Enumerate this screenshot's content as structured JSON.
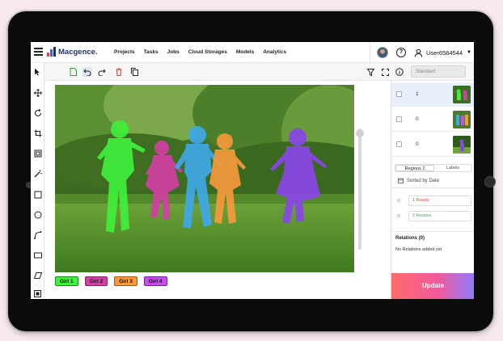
{
  "app": {
    "logo_text": "Macgence.",
    "nav": [
      "Projects",
      "Tasks",
      "Jobs",
      "Cloud Storages",
      "Models",
      "Analytics"
    ],
    "username": "User6584544"
  },
  "toolbar": {
    "preset_value": "Standard"
  },
  "annotations": {
    "tags": [
      {
        "label": "Girl 1",
        "color": "#3ff03a"
      },
      {
        "label": "Girl 2",
        "color": "#d13fa2"
      },
      {
        "label": "Girl 3",
        "color": "#f59a3c"
      },
      {
        "label": "Girl 4",
        "color": "#c34fe6"
      }
    ]
  },
  "right_panel": {
    "thumbs": [
      {
        "count": "1"
      },
      {
        "count": "0"
      },
      {
        "count": "0"
      }
    ],
    "tabs": [
      "Regions 2",
      "Labels"
    ],
    "sorted_label": "Sorted by Date",
    "regions": [
      {
        "label": "1  Roads",
        "color": "#e2463c"
      },
      {
        "label": "2  Houses",
        "color": "#3cae4a"
      }
    ],
    "relations_title": "Relations (0)",
    "relations_empty": "No Relations added yet",
    "update_label": "Update"
  },
  "colors": {
    "accent_blue": "#1f2f5f",
    "update_gradient_start": "#ff6b6b",
    "update_gradient_end": "#8f7bff"
  }
}
